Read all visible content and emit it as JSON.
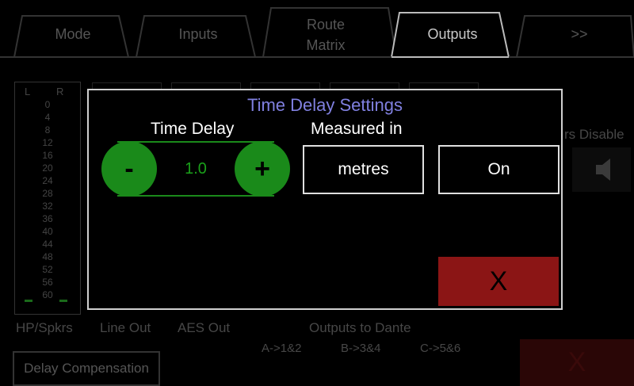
{
  "tabs": [
    {
      "label": "Mode"
    },
    {
      "label": "Inputs"
    },
    {
      "label": "Route Matrix"
    },
    {
      "label": "Outputs"
    },
    {
      "label": ">>"
    }
  ],
  "meter": {
    "left_label": "L",
    "right_label": "R",
    "scale": [
      "0",
      "4",
      "8",
      "12",
      "16",
      "20",
      "24",
      "28",
      "32",
      "36",
      "40",
      "44",
      "48",
      "52",
      "56",
      "60"
    ]
  },
  "background": {
    "speakers_disable_label": "rs Disable",
    "output_labels": [
      "HP/Spkrs",
      "Line Out",
      "AES Out"
    ],
    "dante_title": "Outputs to Dante",
    "dante_routes": [
      "A->1&2",
      "B->3&4",
      "C->5&6"
    ],
    "delay_comp_label": "Delay Compensation",
    "bottom_close_label": "X"
  },
  "dialog": {
    "title": "Time Delay Settings",
    "time_delay_label": "Time Delay",
    "measured_in_label": "Measured in",
    "decrement_label": "-",
    "increment_label": "+",
    "value": "1.0",
    "unit_button": "metres",
    "toggle_button": "On",
    "close_button": "X"
  },
  "colors": {
    "accent_title": "#8080e0",
    "stepper_green": "#1a8a1a",
    "close_red": "#8b1515"
  }
}
